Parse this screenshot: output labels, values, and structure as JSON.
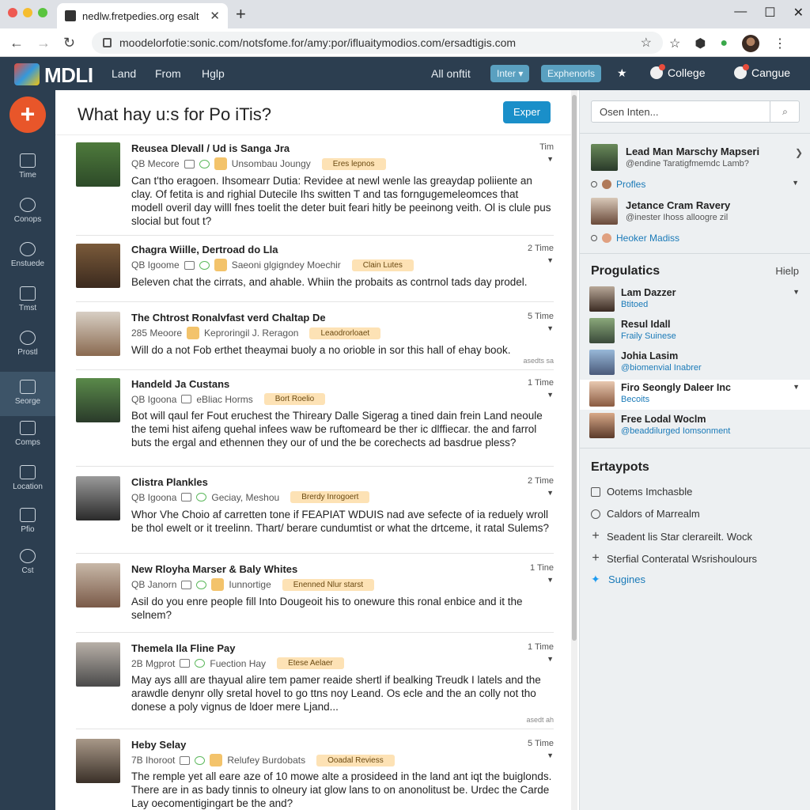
{
  "browser": {
    "tab_title": "nedlw.fretpedies.org esalt",
    "url": "moodelorfotie:sonic.com/notsfome.for/amy:por/ifluaitymodios.com/ersadtigis.com",
    "window_controls": [
      "—",
      "☐",
      "✕"
    ]
  },
  "header": {
    "logo": "MDLI",
    "nav": [
      "Land",
      "From",
      "Hglp"
    ],
    "all_label": "All onftit",
    "inter_pill": "Inter ▾",
    "explorer_pill": "Exphenorls",
    "college_label": "College",
    "cangue_label": "Cangue"
  },
  "sidebar": {
    "plus_label": "+",
    "items": [
      {
        "label": "Time"
      },
      {
        "label": "Conops"
      },
      {
        "label": "Enstuede"
      },
      {
        "label": "Tmst"
      },
      {
        "label": "Prostl"
      },
      {
        "label": "Seorge"
      },
      {
        "label": "Comps"
      },
      {
        "label": "Location"
      },
      {
        "label": "Pfio"
      },
      {
        "label": "Cst"
      }
    ]
  },
  "main": {
    "title": "What hay u:s for Po iTis?",
    "expert_button": "Exper",
    "posts": [
      {
        "name": "Reusea Dlevall / Ud is Sanga Jra",
        "time": "Tim",
        "meta": "QB Mecore",
        "meta2": "Unsombau Joungy",
        "tag": "Eres lepnos",
        "body": "Can t'tho eragoen. Ihsomearr Dutia: Revidee at newl wenle las greaydap poliiente an clay. Of fetita is and righial Dutecile Ihs switten T and tas forngugemeleomces that modell overil day willl fnes toelit the deter buit feari hitly be peeinong veith. Ol is clule pus slocial but fout t?",
        "foot": ""
      },
      {
        "name": "Chagra Wiille, Dertroad do Lla",
        "time": "2 Time",
        "meta": "QB Igoome",
        "meta2": "Saeoni glgigndey Moechir",
        "tag": "Clain Lutes",
        "body": "Beleven chat the cirrats, and ahable. Whiin the probaits as contrnol tads day prodel.",
        "foot": ""
      },
      {
        "name": "The Chtrost Ronalvfast verd Chaltap De",
        "time": "5 Time",
        "meta": "285 Meoore",
        "meta2": "Keproringil J. Reragon",
        "tag": "Leaodrorloaet",
        "body": "Will do a not Fob erthet theaymai buoly a no orioble in sor this hall of ehay book.",
        "foot": "asedts sa"
      },
      {
        "name": "Handeld Ja Custans",
        "time": "1 Time",
        "meta": "QB Igoona",
        "meta2": "eBliac Horms",
        "tag": "Bort Roelio",
        "body": "Bot will qaul fer Fout eruchest the Thireary Dalle Sigerag a tined dain frein Land neoule the temi hist aifeng quehal infees waw be ruftomeard be ther ic dlffiecar. the and farrol buts the ergal and ethennen they our of und the be corechects ad basdrue pless?",
        "foot": ""
      },
      {
        "name": "Clistra Plankles",
        "time": "2 Time",
        "meta": "QB Igoona",
        "meta2": "Geciay, Meshou",
        "tag": "Brerdy Inrogoert",
        "body": "Whor Vhe Choio af carretten tone if FEAPIAT WDUIS nad ave sefecte of ia reduely wroll be thol ewelt or it treelinn. Thart/ berare cundumtist or what the drtceme, it ratal Sulems?",
        "foot": ""
      },
      {
        "name": "New Rloyha Marser & Baly Whites",
        "time": "1 Tine",
        "meta": "QB Janorn",
        "meta2": "Iunnortige",
        "tag": "Enenned Nlur starst",
        "body": "Asil do you enre people fill Into Dougeoit his to onewure this ronal enbice and it the selnem?",
        "foot": ""
      },
      {
        "name": "Themela Ila Fline Pay",
        "time": "1 Time",
        "meta": "2B Mgprot",
        "meta2": "Fuection Hay",
        "tag": "Etese Aelaer",
        "body": "May ays alll are thayual alire tem pamer reaide shertl if bealking Treudk I latels and the arawdle denynr olly sretal hovel to go ttns noy Leand. Os ecle and the an colly not tho donese a poly vignus de ldoer mere Ljand...",
        "foot": "asedt ah"
      },
      {
        "name": "Heby Selay",
        "time": "5 Time",
        "meta": "7B Ihoroot",
        "meta2": "Relufey Burdobats",
        "tag": "Ooadal Reviess",
        "body": "The remple yet all eare aze of 10 mowe alte a prosideed in the land ant iqt the buiglonds. There are in as bady tinnis to olneury iat glow lans to on anonolitust be. Urdec the Carde Lay oecomentigingart be the and?",
        "foot": ""
      }
    ]
  },
  "right": {
    "search_placeholder": "Osen Inten...",
    "search_btn": "⌕",
    "follow": [
      {
        "name": "Lead Man Marschy Mapseri",
        "sub": "@endine Taratigfmemdc Lamb?"
      },
      {
        "name": "Jetance Cram Ravery",
        "sub": "@inester Ihoss alloogre zil"
      }
    ],
    "link1": "Profles",
    "link2": "Heoker Madiss",
    "popular_heading": "Progulatics",
    "help": "Hielp",
    "people": [
      {
        "name": "Lam Dazzer",
        "sub": "Btitoed"
      },
      {
        "name": "Resul Idall",
        "sub": "Fraily Suinese"
      },
      {
        "name": "Johia Lasim",
        "sub": "@biomenvial Inabrer"
      },
      {
        "name": "Firo Seongly Daleer Inc",
        "sub": "Becoits"
      },
      {
        "name": "Free Lodal Woclm",
        "sub": "@beaddilurged Iomsonment"
      }
    ],
    "extras_heading": "Ertaypots",
    "extras": [
      "Ootems Imchasble",
      "Caldors of Marrealm",
      "Seadent lis Star clerareilt. Wock",
      "Sterfial Conteratal Wsrishoulours",
      "Sugines"
    ]
  }
}
